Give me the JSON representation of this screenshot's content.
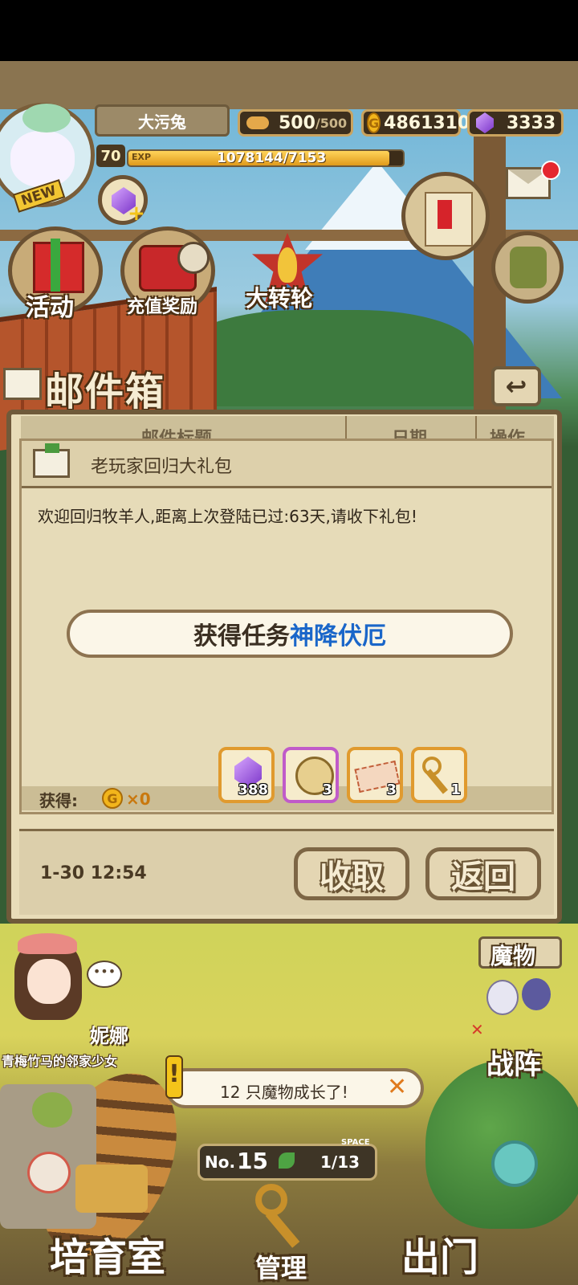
{
  "player": {
    "name": "大污兔",
    "level": "70",
    "exp_label": "EXP",
    "exp_value": "1078144/7153",
    "exp_fraction": 0.95,
    "new_badge": "NEW"
  },
  "resources": {
    "stamina": "500",
    "stamina_max": "/500",
    "gold": "4861310",
    "gems": "3333",
    "gold_symbol": "G"
  },
  "features": {
    "activity": "活动",
    "recharge": "充值奖励",
    "wheel": "大转轮"
  },
  "mail": {
    "title": "邮件箱",
    "col_title": "邮件标题",
    "col_date": "日期",
    "col_action": "操作",
    "subject": "老玩家回归大礼包",
    "body": "欢迎回归牧羊人,距离上次登陆已过:63天,请收下礼包!",
    "task_prefix": "获得任务 ",
    "task_name": "神降伏厄",
    "gain_label": "获得:",
    "gain_gold": "×0",
    "rewards": [
      {
        "icon": "purple-gem-icon",
        "count": "388"
      },
      {
        "icon": "treasure-sack-icon",
        "count": "3"
      },
      {
        "icon": "ticket-icon",
        "count": "3"
      },
      {
        "icon": "golden-key-icon",
        "count": "1"
      }
    ],
    "date": "1-30 12:54",
    "collect_button": "收取",
    "back_button": "返回"
  },
  "bottom": {
    "npc_name": "妮娜",
    "npc_subtitle": "青梅竹马的邻家少女",
    "notification": "12 只魔物成长了!",
    "monsters_label": "魔物",
    "formation_label": "战阵",
    "pen_number_prefix": "No.",
    "pen_number": "15",
    "space_label": "SPACE",
    "space_value": "1/13",
    "nursery": "培育室",
    "manage": "管理",
    "depart": "出门"
  },
  "colors": {
    "panel_bg": "#e8dcb8",
    "panel_border": "#6f5a3a",
    "task_name": "#1a66c9",
    "reward_border": "#e09a2e",
    "highlight_reward_border": "#c05bc9"
  }
}
